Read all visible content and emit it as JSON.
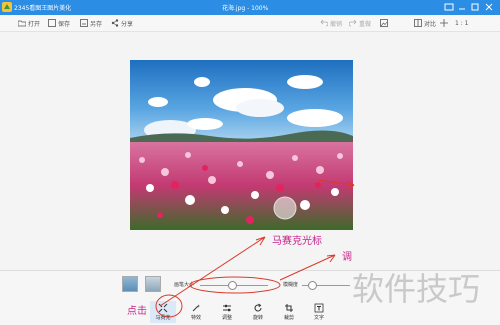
{
  "titlebar": {
    "app_title": "2345看图王图片美化",
    "doc_title": "花海.jpg - 100%"
  },
  "toolbar": {
    "open": "打开",
    "save": "保存",
    "save_as": "另存",
    "share": "分享",
    "undo": "撤销",
    "redo": "重做",
    "compare": "对比",
    "ratio": "1 : 1"
  },
  "panel": {
    "brush_size_label": "画笔大小",
    "blur_label": "模糊度",
    "brush_size_value": 0.47,
    "blur_value": 0.2
  },
  "tools": [
    {
      "label": "马赛克"
    },
    {
      "label": "特效"
    },
    {
      "label": "调整"
    },
    {
      "label": "旋转"
    },
    {
      "label": "裁剪"
    },
    {
      "label": "文字"
    }
  ],
  "annotations": {
    "cursor_note": "马赛克光标",
    "click_note": "点击",
    "adjust_note": "调",
    "watermark": "软件技巧"
  },
  "colors": {
    "title_bar": "#2b8de3",
    "annotation": "#c8248c",
    "arrow": "#d93a2b"
  }
}
